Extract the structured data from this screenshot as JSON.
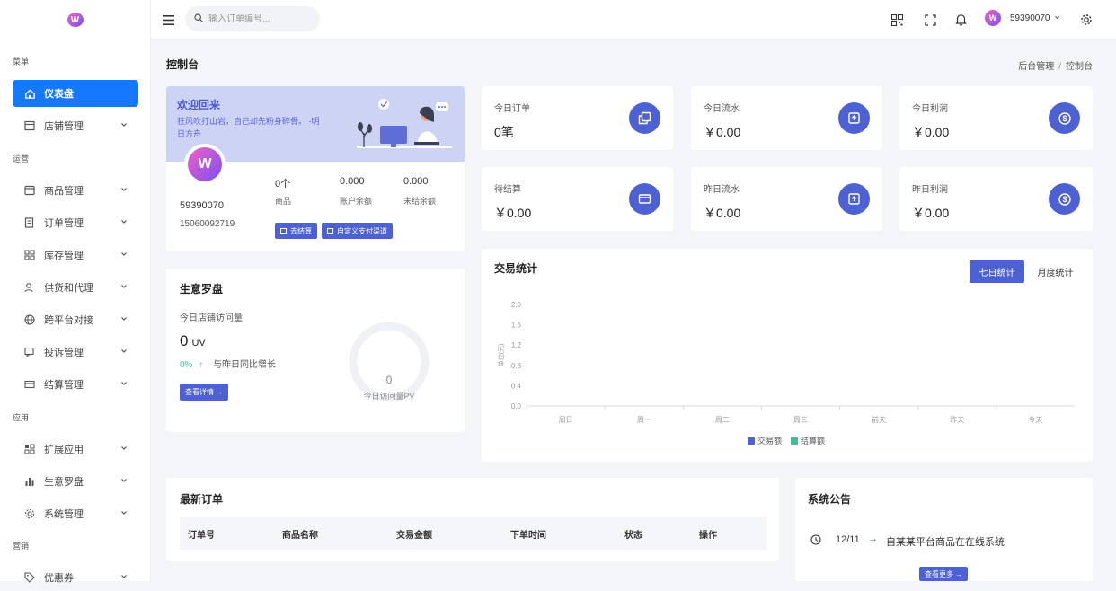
{
  "sidebar": {
    "sections": {
      "menu": "菜单",
      "ops": "运营",
      "apps": "应用",
      "marketing": "营销"
    },
    "items": [
      {
        "label": "仪表盘"
      },
      {
        "label": "店铺管理"
      },
      {
        "label": "商品管理"
      },
      {
        "label": "订单管理"
      },
      {
        "label": "库存管理"
      },
      {
        "label": "供货和代理"
      },
      {
        "label": "跨平台对接"
      },
      {
        "label": "投诉管理"
      },
      {
        "label": "结算管理"
      },
      {
        "label": "扩展应用"
      },
      {
        "label": "生意罗盘"
      },
      {
        "label": "系统管理"
      },
      {
        "label": "优惠券"
      }
    ]
  },
  "topbar": {
    "search_placeholder": "输入订单编号...",
    "username": "59390070"
  },
  "page": {
    "title": "控制台",
    "breadcrumb": [
      "后台管理",
      "控制台"
    ]
  },
  "welcome": {
    "title": "欢迎回来",
    "subtitle": "狂风吹打山岩，自己却先粉身碎骨。 -明日方舟",
    "username": "59390070",
    "phone": "15060092719",
    "stats": [
      {
        "value": "0个",
        "label": "商品"
      },
      {
        "value": "0.000",
        "label": "账户余额"
      },
      {
        "value": "0.000",
        "label": "未结余额"
      }
    ],
    "btn_settle": "去结算",
    "btn_custom_pay": "自定义支付渠道"
  },
  "stat_cards": [
    {
      "title": "今日订单",
      "value": "0笔",
      "icon": "copy-icon"
    },
    {
      "title": "今日流水",
      "value": "￥0.00",
      "icon": "box-icon"
    },
    {
      "title": "今日利润",
      "value": "￥0.00",
      "icon": "dollar-icon"
    },
    {
      "title": "待结算",
      "value": "￥0.00",
      "icon": "card-icon"
    },
    {
      "title": "昨日流水",
      "value": "￥0.00",
      "icon": "box-icon"
    },
    {
      "title": "昨日利润",
      "value": "￥0.00",
      "icon": "dollar-icon"
    }
  ],
  "compass": {
    "title": "生意罗盘",
    "visits_label": "今日店铺访问量",
    "uv_value": "0",
    "uv_unit": "UV",
    "growth_pct": "0%",
    "growth_arrow": "↑",
    "growth_text": "与昨日同比增长",
    "details_btn": "查看详情 →",
    "gauge_value": "0",
    "gauge_label": "今日访问量PV",
    "gauge_fraction": 0
  },
  "trade_stats": {
    "title": "交易统计",
    "tab_week": "七日统计",
    "tab_month": "月度统计"
  },
  "chart_data": {
    "type": "line",
    "categories": [
      "周日",
      "周一",
      "周二",
      "周三",
      "前天",
      "昨天",
      "今天"
    ],
    "series": [
      {
        "name": "交易额",
        "values": [
          0,
          0,
          0,
          0,
          0,
          0,
          0
        ],
        "color": "#4e61d3"
      },
      {
        "name": "结算额",
        "values": [
          0,
          0,
          0,
          0,
          0,
          0,
          0
        ],
        "color": "#3fbf95"
      }
    ],
    "yticks": [
      "0.0",
      "0.4",
      "0.8",
      "1.2",
      "1.6",
      "2.0"
    ],
    "ylim": [
      0,
      2.0
    ],
    "ylabel": "单位(元)",
    "legend": "bottom"
  },
  "orders": {
    "title": "最新订单",
    "columns": [
      "订单号",
      "商品名称",
      "交易金额",
      "下单时间",
      "状态",
      "操作"
    ]
  },
  "notice": {
    "title": "系统公告",
    "date": "12/11",
    "arrow": "→",
    "text": "自某某平台商品在在线系统",
    "more_btn": "查看更多 →"
  },
  "colors": {
    "primary": "#1677ff",
    "accent": "#4e61d3",
    "green": "#3fbf95"
  }
}
